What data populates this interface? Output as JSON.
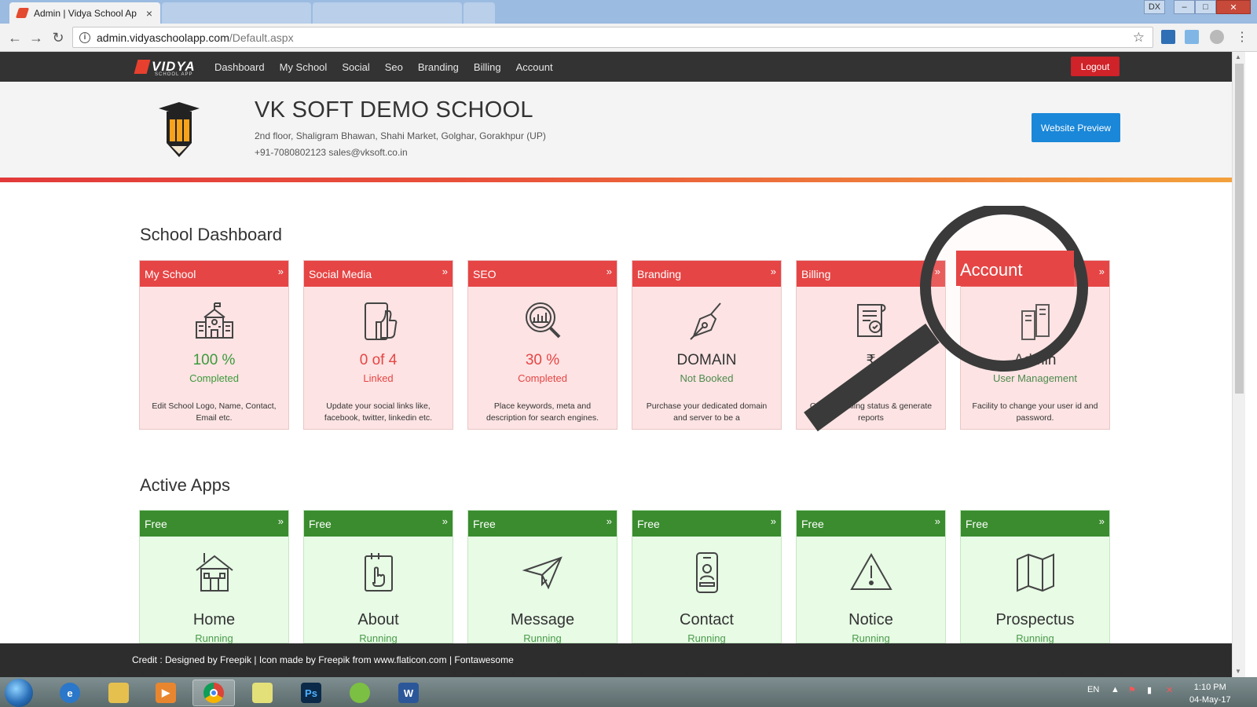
{
  "browser": {
    "tab_title": "Admin | Vidya School Ap",
    "tab_close": "×",
    "url_host": "admin.vidyaschoolapp.com",
    "url_path": "/Default.aspx",
    "window_badge": "DX",
    "nav_back": "←",
    "nav_forward": "→",
    "nav_reload": "↻"
  },
  "site": {
    "logo_text": "VIDYA",
    "logo_sub": "SCHOOL APP",
    "menu": [
      "Dashboard",
      "My School",
      "Social",
      "Seo",
      "Branding",
      "Billing",
      "Account"
    ],
    "logout_label": "Logout"
  },
  "school": {
    "name": "VK SOFT DEMO SCHOOL",
    "address": "2nd floor, Shaligram Bhawan, Shahi Market, Golghar, Gorakhpur (UP)",
    "contact": "+91-7080802123  sales@vksoft.co.in",
    "preview_label": "Website Preview"
  },
  "dashboard": {
    "title": "School Dashboard",
    "cards": [
      {
        "title": "My School",
        "value": "100 %",
        "status": "Completed",
        "desc": "Edit School Logo, Name, Contact, Email etc.",
        "icon": "school-building-icon"
      },
      {
        "title": "Social Media",
        "value": "0 of 4",
        "status": "Linked",
        "desc": "Update your social links like, facebook, twitter, linkedin etc.",
        "icon": "thumbs-up-icon"
      },
      {
        "title": "SEO",
        "value": "30 %",
        "status": "Completed",
        "desc": "Place keywords, meta and description for search engines.",
        "icon": "seo-magnifier-icon"
      },
      {
        "title": "Branding",
        "value": "DOMAIN",
        "status": "Not Booked",
        "desc": "Purchase your dedicated domain and server to be a",
        "icon": "pen-nib-icon"
      },
      {
        "title": "Billing",
        "value": "₹",
        "status": "",
        "desc": "Get your billing status & generate reports",
        "icon": "invoice-icon"
      },
      {
        "title": "Account",
        "value": "Admin",
        "status": "User Management",
        "desc": "Facility to change your user id and password.",
        "icon": "server-icon"
      }
    ]
  },
  "apps": {
    "title": "Active Apps",
    "cards": [
      {
        "badge": "Free",
        "name": "Home",
        "status": "Running",
        "icon": "house-icon"
      },
      {
        "badge": "Free",
        "name": "About",
        "status": "Running",
        "icon": "hand-book-icon"
      },
      {
        "badge": "Free",
        "name": "Message",
        "status": "Running",
        "icon": "paper-plane-icon"
      },
      {
        "badge": "Free",
        "name": "Contact",
        "status": "Running",
        "icon": "phone-contact-icon"
      },
      {
        "badge": "Free",
        "name": "Notice",
        "status": "Running",
        "icon": "warning-triangle-icon"
      },
      {
        "badge": "Free",
        "name": "Prospectus",
        "status": "Running",
        "icon": "map-book-icon"
      }
    ]
  },
  "footer": {
    "credit": "Credit : Designed by Freepik | Icon made by Freepik from www.flaticon.com | Fontawesome"
  },
  "taskbar": {
    "lang": "EN",
    "time": "1:10 PM",
    "date": "04-May-17",
    "ps_label": "Ps",
    "word_label": "W"
  },
  "colors": {
    "accent_red": "#e64545",
    "accent_green": "#3a8c2e",
    "nav_dark": "#333333",
    "preview_blue": "#1a87d8",
    "logout_red": "#cf2229"
  }
}
